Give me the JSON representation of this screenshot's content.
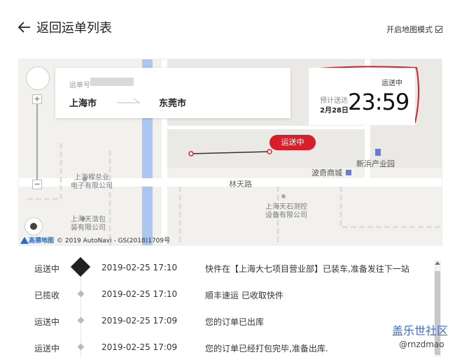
{
  "header": {
    "back_label": "返回运单列表",
    "map_mode_label": "开启地图模式",
    "map_mode_checked": true
  },
  "waybill": {
    "label": "运单号",
    "from_city": "上海市",
    "to_city": "东莞市"
  },
  "eta": {
    "status": "运送中",
    "label": "预计送达",
    "date": "2月28日",
    "time": "23:59"
  },
  "map": {
    "badge": "运送中",
    "labels": {
      "poi1": "上海樑总业",
      "poi1b": "电子有限公司",
      "poi2": "上海天浩包",
      "poi2b": "装有限公司",
      "poi3": "上海天石测控",
      "poi3b": "设备有限公司",
      "mall": "波奇商城",
      "park": "新浜产业园",
      "road": "林天路"
    },
    "attribution_logo": "高德地图",
    "attribution_text": "© 2019 AutoNavi - GS(2018)1709号",
    "accent_color": "#d61f2a"
  },
  "timeline": [
    {
      "status": "运送中",
      "time": "2019-02-25 17:10",
      "desc": "快件在【上海大七项目营业部】已装车,准备发往下一站",
      "active": true
    },
    {
      "status": "已揽收",
      "time": "2019-02-25 17:10",
      "desc": "顺丰速运 已收取快件",
      "active": false
    },
    {
      "status": "运送中",
      "time": "2019-02-25 17:09",
      "desc": "您的订单已出库",
      "active": false
    },
    {
      "status": "运送中",
      "time": "2019-02-25 17:09",
      "desc": "您的订单已经打包完毕,准备出库.",
      "active": false
    }
  ],
  "watermark": {
    "title": "盖乐世社区",
    "user": "@rnzdmao"
  }
}
